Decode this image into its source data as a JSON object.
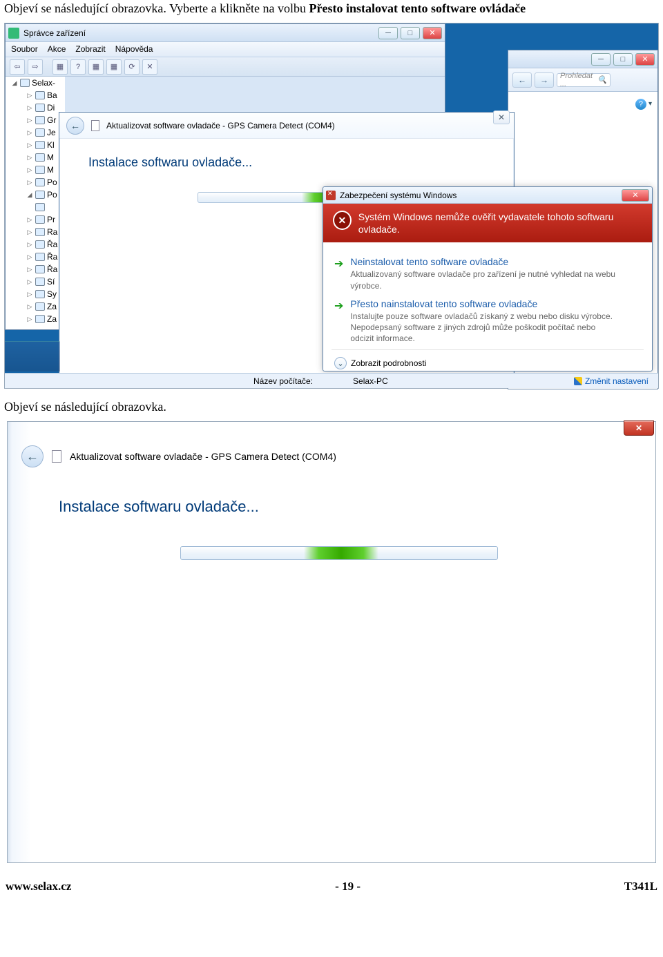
{
  "doc": {
    "line1a": "Objeví se následující obrazovka. Vyberte a klikněte na volbu ",
    "line1b": "Přesto instalovat tento software ovládače",
    "line2": "Objeví se následující obrazovka."
  },
  "devmgr": {
    "title": "Správce zařízení",
    "menus": [
      "Soubor",
      "Akce",
      "Zobrazit",
      "Nápověda"
    ],
    "root": "Selax-",
    "items": [
      "Ba",
      "Di",
      "Gr",
      "Je",
      "Kl",
      "M",
      "M",
      "Po",
      "Po",
      "Pr",
      "Ra",
      "Řa",
      "Řa",
      "Řa",
      "Sí",
      "Sy",
      "Za",
      "Za"
    ]
  },
  "browser": {
    "search_placeholder": "Prohledat ..."
  },
  "wizard": {
    "close": "✕",
    "head": "Aktualizovat software ovladače - GPS Camera Detect (COM4)",
    "title": "Instalace softwaru ovladače..."
  },
  "security": {
    "win_title": "Zabezpečení systému Windows",
    "red_text": "Systém Windows nemůže ověřit vydavatele tohoto softwaru ovladače.",
    "opt1_title": "Neinstalovat tento software ovladače",
    "opt1_desc": "Aktualizovaný software ovladače pro zařízení je nutné vyhledat na webu výrobce.",
    "opt2_title": "Přesto nainstalovat tento software ovladače",
    "opt2_desc": "Instalujte pouze software ovladačů získaný z webu nebo disku výrobce. Nepodepsaný software z jiných zdrojů může poškodit počítač nebo odcizit informace.",
    "details": "Zobrazit podrobnosti"
  },
  "status": {
    "label1": "Název počítače:",
    "value1": "Selax-PC",
    "change": "Změnit nastavení"
  },
  "footer": {
    "url": "www.selax.cz",
    "page": "- 19 -",
    "model": "T341L"
  }
}
